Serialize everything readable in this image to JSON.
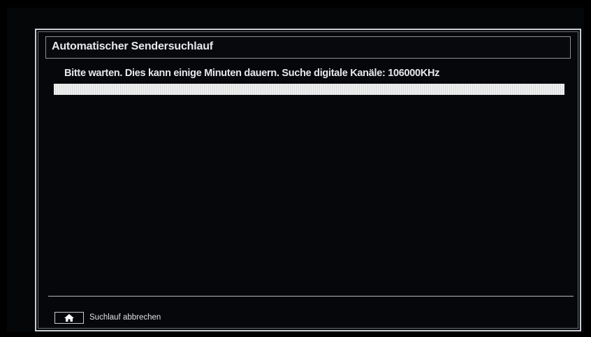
{
  "dialog": {
    "title": "Automatischer Sendersuchlauf",
    "status": "Bitte warten. Dies kann einige Minuten dauern. Suche digitale Kanäle: 106000KHz",
    "progress_percent": 100
  },
  "footer": {
    "key_icon": "home-icon",
    "cancel_label": "Suchlauf abbrechen"
  },
  "colors": {
    "background": "#000000",
    "border": "#c9ccd0",
    "text": "#e6e8ea",
    "progress_fill": "#eef0f0"
  }
}
